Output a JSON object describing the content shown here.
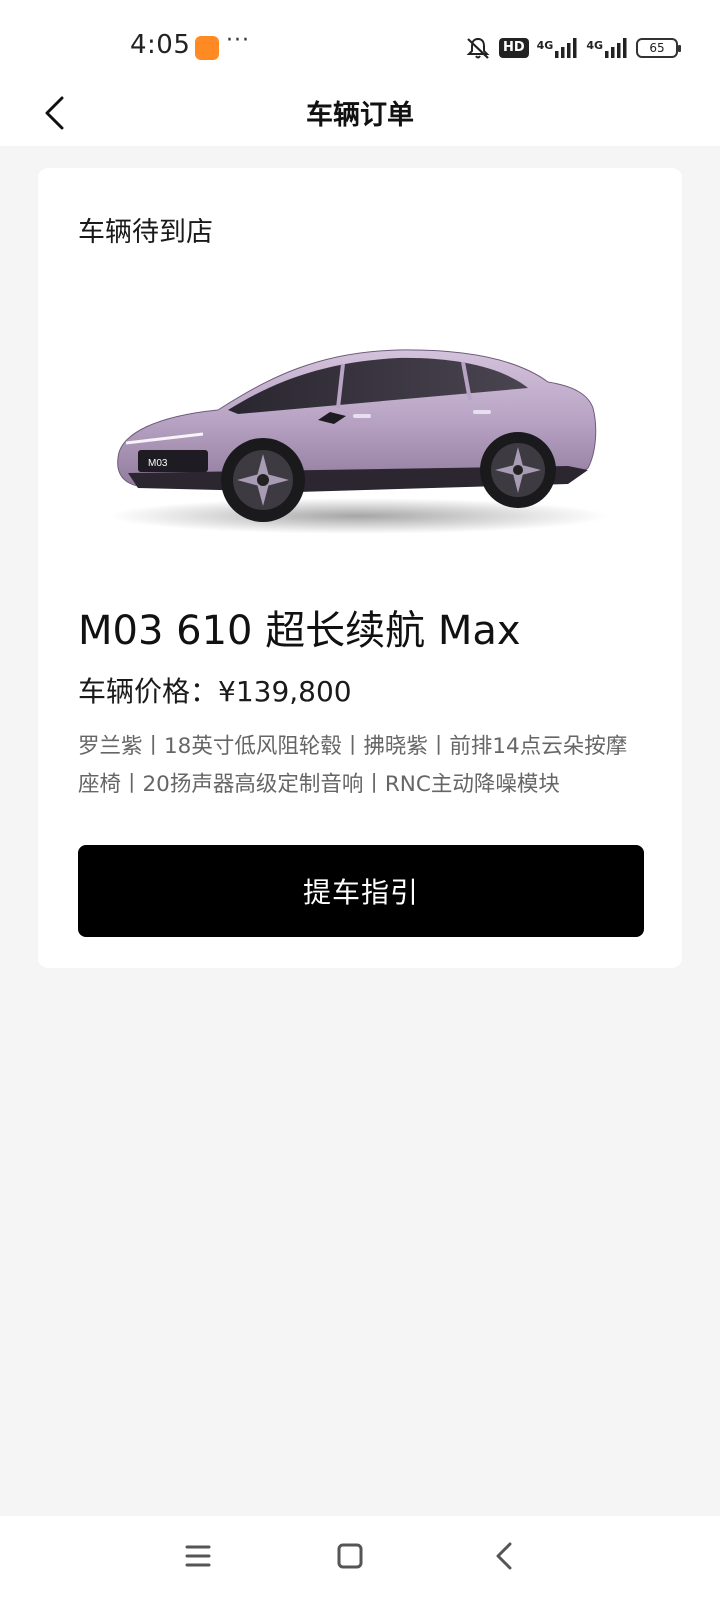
{
  "status_bar": {
    "time": "4:05",
    "more": "···",
    "hd_label": "HD",
    "network_1": "4G",
    "network_2": "4G",
    "battery": "65"
  },
  "nav": {
    "title": "车辆订单"
  },
  "order": {
    "status": "车辆待到店",
    "model": "M03 610 超长续航 Max",
    "price": "车辆价格：¥139,800",
    "options": "罗兰紫丨18英寸低风阻轮毂丨拂晓紫丨前排14点云朵按摩座椅丨20扬声器高级定制音响丨RNC主动降噪模块",
    "button_label": "提车指引",
    "car_badge": "M03"
  },
  "colors": {
    "background": "#f5f5f5",
    "card": "#ffffff",
    "button": "#000000",
    "button_text": "#ffffff",
    "car_body": "#b8a3c4"
  },
  "icons": {
    "back": "chevron-left-icon",
    "menu": "menu-icon",
    "home": "home-square-icon",
    "system_back": "system-back-icon"
  }
}
